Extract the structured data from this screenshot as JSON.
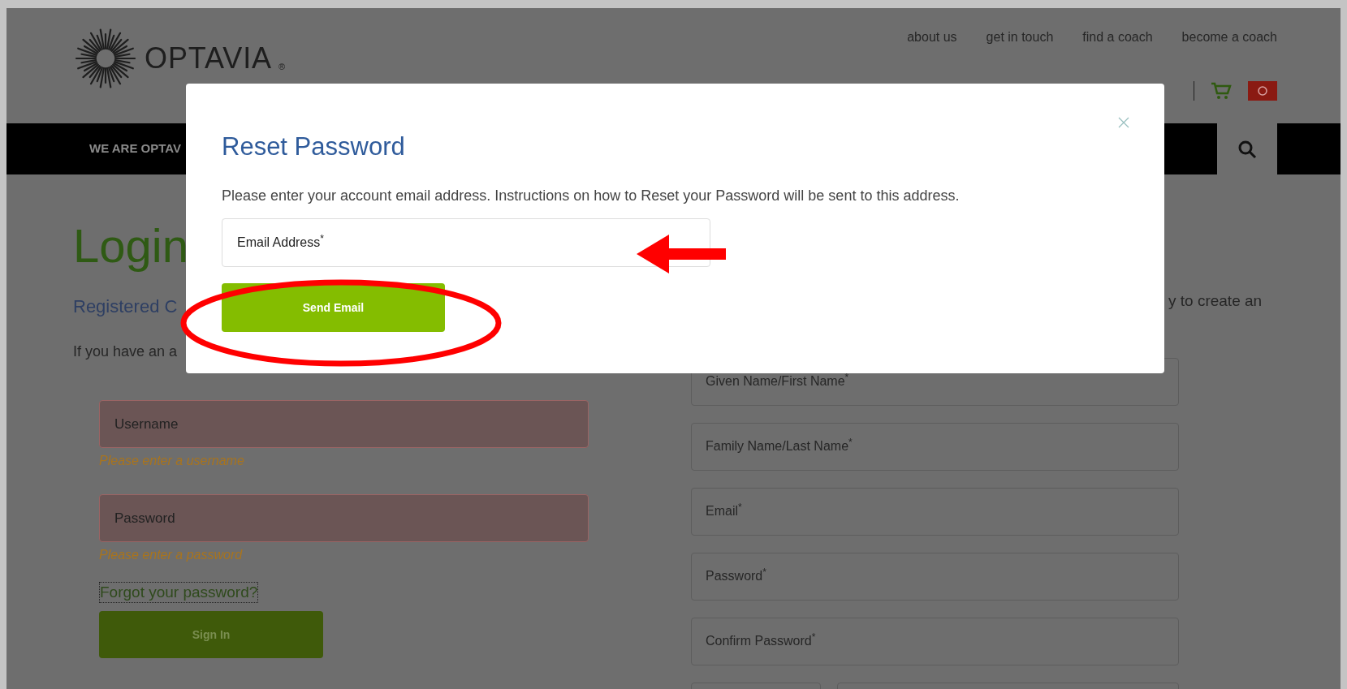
{
  "header": {
    "logo": "OPTAVIA",
    "logo_mark": "®",
    "links": [
      "about us",
      "get in touch",
      "find a coach",
      "become a coach"
    ]
  },
  "nav": {
    "items": [
      "WE ARE OPTAV"
    ]
  },
  "login": {
    "title": "Login",
    "subtitle": "Registered C",
    "intro": "If you have an a",
    "fields": [
      {
        "label": "Username",
        "error": "Please enter a username"
      },
      {
        "label": "Password",
        "error": "Please enter a password"
      }
    ],
    "forgot_link": "Forgot your password?",
    "button": "Sign In"
  },
  "register": {
    "intro": "y to create an",
    "fields": [
      {
        "label": "Given Name/First Name$^{*}$"
      },
      {
        "label": "Family Name/Last Name$^{*}$"
      },
      {
        "label": "Email$^{*}$"
      },
      {
        "label": "Password$^{*}$"
      },
      {
        "label": "Confirm Password$^{*}$"
      }
    ]
  },
  "modal": {
    "title": "Reset Password",
    "text": "Please enter your account email address. Instructions on how to Reset your Password will be sent to this address.",
    "field": {
      "label": "Email Address$^{*}$"
    },
    "button": "Send Email"
  }
}
